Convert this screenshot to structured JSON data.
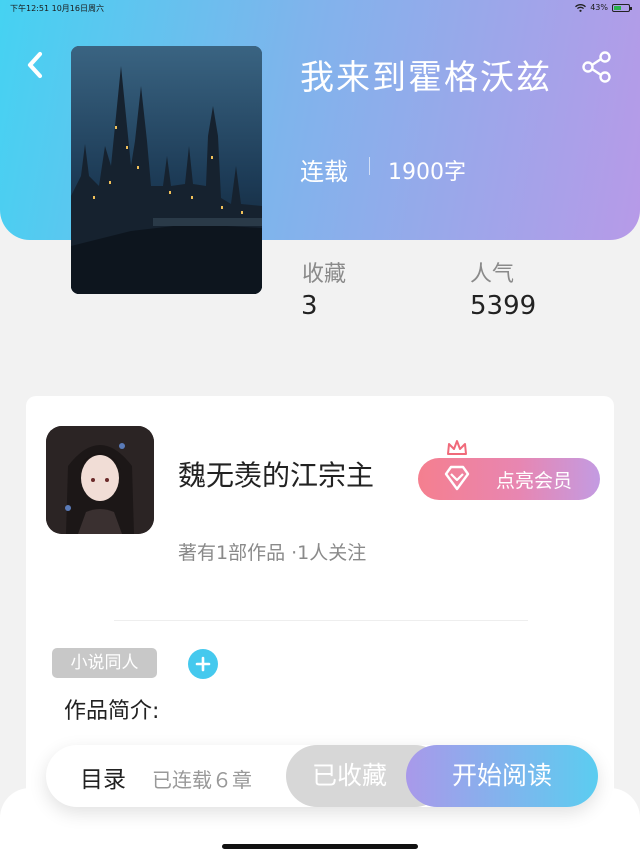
{
  "status_bar": {
    "time": "下午12:51",
    "date": "10月16日周六",
    "battery": "43%"
  },
  "book": {
    "title": "我来到霍格沃兹",
    "status": "连载",
    "word_count": "1900字"
  },
  "stats": {
    "collect_label": "收藏",
    "collect_value": "3",
    "popularity_label": "人气",
    "popularity_value": "5399"
  },
  "author": {
    "name": "魏无羡的江宗主",
    "vip_label": "点亮会员",
    "summary": "著有1部作品 ·1人关注"
  },
  "tags": [
    "小说同人"
  ],
  "intro_label": "作品简介:",
  "action_bar": {
    "toc_label": "目录",
    "chapters_label": "已连载６章",
    "collected_label": "已收藏",
    "read_label": "开始阅读"
  },
  "colors": {
    "header_gradient_start": "#45d2f2",
    "header_gradient_end": "#b79ae8",
    "vip_gradient_start": "#f57f8f",
    "vip_gradient_end": "#c39be2",
    "read_gradient_start": "#a999ea",
    "read_gradient_end": "#5bcdf0",
    "add_button": "#45c9ee"
  },
  "icons": {
    "back": "chevron-left-icon",
    "share": "share-icon",
    "vip": "diamond-icon",
    "crown": "crown-icon",
    "add": "plus-icon",
    "wifi": "wifi-icon",
    "battery": "battery-icon"
  }
}
